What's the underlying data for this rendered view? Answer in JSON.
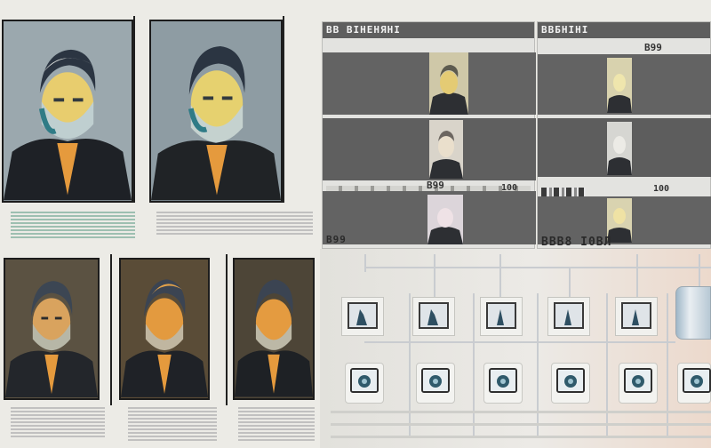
{
  "windows": [
    {
      "title": "ВВ ВІНЕНЯНІ",
      "counts": [
        "",
        "",
        ""
      ]
    },
    {
      "title": "ВВБНІНІ",
      "counts": [
        "В99",
        "",
        "100"
      ]
    }
  ],
  "left_window_footer": "В99",
  "right_window_footer": "ВВВ8 І0ВЛ",
  "mid_labels": [
    "В99",
    "100"
  ],
  "colors": {
    "background": "#ecebe6",
    "window_title": "#5e5e5e",
    "pane": "#636363",
    "portrait_blue_bg": "#9aa7ae",
    "portrait_warm_bg": "#5b5242",
    "accent_teal": "#8fb7a8",
    "accent_orange": "#e39a3f"
  },
  "icons": {
    "portrait": "person-portrait-icon",
    "monitor": "monitor-icon",
    "device": "camera-device-icon",
    "storage": "storage-cylinder-icon"
  }
}
